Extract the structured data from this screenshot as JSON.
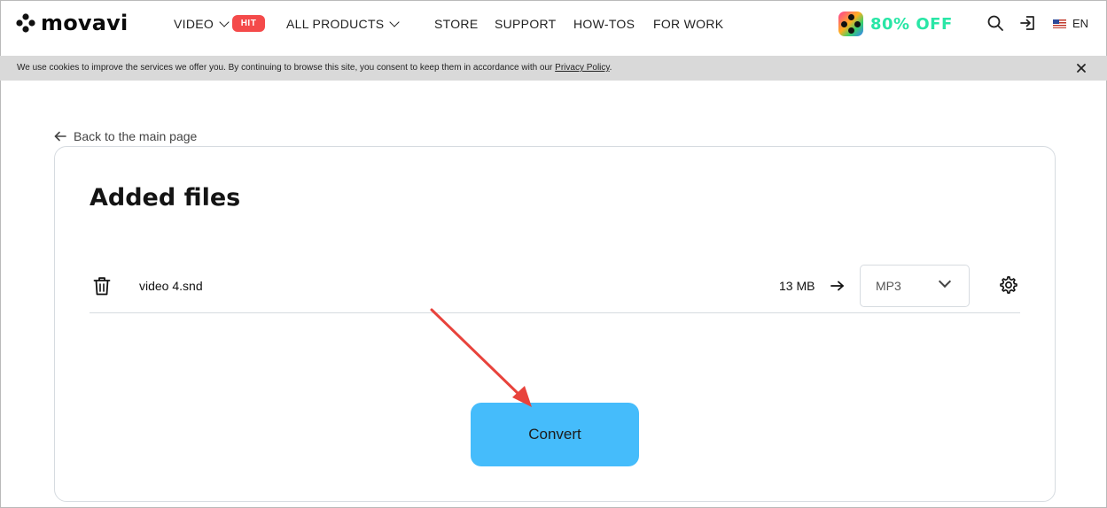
{
  "header": {
    "logo_text": "movavi",
    "nav": {
      "video": "VIDEO",
      "hit_badge": "HIT",
      "all_products": "ALL PRODUCTS",
      "store": "STORE",
      "support": "SUPPORT",
      "howtos": "HOW-TOS",
      "for_work": "FOR WORK"
    },
    "promo_text": "80% OFF",
    "language": "EN",
    "icons": [
      "search-icon",
      "login-icon",
      "us-flag-icon"
    ]
  },
  "cookie_bar": {
    "text": "We use cookies to improve the services we offer you. By continuing to browse this site, you consent to keep them in accordance with our ",
    "link_text": "Privacy Policy",
    "suffix": "."
  },
  "back_link": "Back to the main page",
  "card": {
    "title": "Added files",
    "files": [
      {
        "name": "video 4.snd",
        "size": "13 MB",
        "format": "MP3"
      }
    ],
    "convert_label": "Convert"
  },
  "colors": {
    "hit_badge": "#f44a4a",
    "promo": "#29e6a6",
    "convert_button": "#45bcfb",
    "cookie_bar": "#d9d9d9",
    "annotation_arrow": "#e8433c"
  }
}
